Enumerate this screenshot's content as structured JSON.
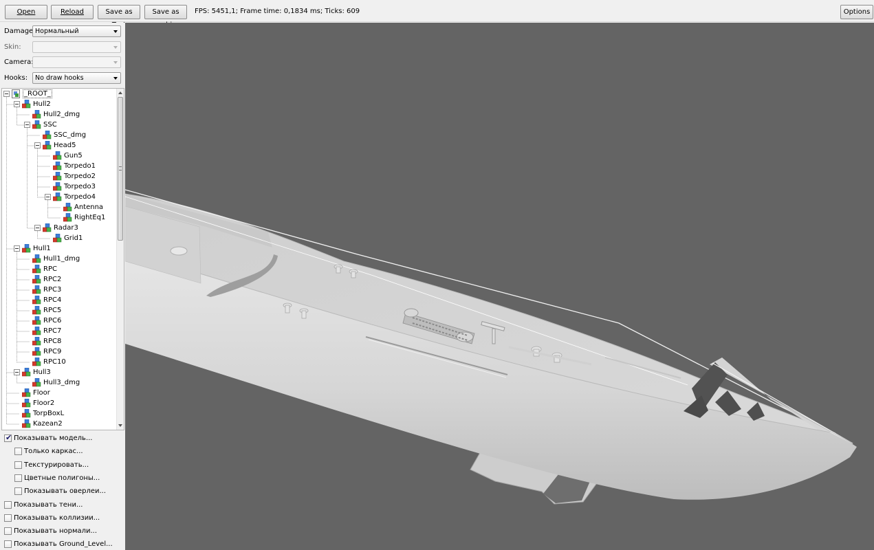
{
  "toolbar": {
    "open_label": "Open",
    "reload_label": "Reload",
    "save_text_label": "Save as Text",
    "save_obj_label": "Save as .obj",
    "status": "FPS: 5451,1; Frame time: 0,1834 ms; Ticks: 609",
    "options_label": "Options"
  },
  "controls": {
    "damage_label": "Damage:",
    "damage_value": "Нормальный",
    "skin_label": "Skin:",
    "skin_value": "",
    "camera_label": "Camera:",
    "camera_value": "",
    "hooks_label": "Hooks:",
    "hooks_value": "No draw hooks"
  },
  "tree": {
    "nodes": [
      {
        "label": "_ROOT_",
        "depth": 0,
        "expander": "minus",
        "icon": "root-icon"
      },
      {
        "label": "Hull2",
        "depth": 1,
        "expander": "minus",
        "icon": "node-icon"
      },
      {
        "label": "Hull2_dmg",
        "depth": 2,
        "expander": "",
        "icon": "node-icon"
      },
      {
        "label": "SSC",
        "depth": 2,
        "expander": "minus",
        "icon": "node-icon"
      },
      {
        "label": "SSC_dmg",
        "depth": 3,
        "expander": "",
        "icon": "node-icon"
      },
      {
        "label": "Head5",
        "depth": 3,
        "expander": "minus",
        "icon": "node-icon"
      },
      {
        "label": "Gun5",
        "depth": 4,
        "expander": "",
        "icon": "node-icon"
      },
      {
        "label": "Torpedo1",
        "depth": 4,
        "expander": "",
        "icon": "node-icon"
      },
      {
        "label": "Torpedo2",
        "depth": 4,
        "expander": "",
        "icon": "node-icon"
      },
      {
        "label": "Torpedo3",
        "depth": 4,
        "expander": "",
        "icon": "node-icon"
      },
      {
        "label": "Torpedo4",
        "depth": 4,
        "expander": "minus",
        "icon": "node-icon"
      },
      {
        "label": "Antenna",
        "depth": 5,
        "expander": "",
        "icon": "node-icon"
      },
      {
        "label": "RightEq1",
        "depth": 5,
        "expander": "",
        "icon": "node-icon"
      },
      {
        "label": "Radar3",
        "depth": 3,
        "expander": "minus",
        "icon": "node-icon"
      },
      {
        "label": "Grid1",
        "depth": 4,
        "expander": "",
        "icon": "node-icon"
      },
      {
        "label": "Hull1",
        "depth": 1,
        "expander": "minus",
        "icon": "node-icon"
      },
      {
        "label": "Hull1_dmg",
        "depth": 2,
        "expander": "",
        "icon": "node-icon"
      },
      {
        "label": "RPC",
        "depth": 2,
        "expander": "",
        "icon": "node-icon"
      },
      {
        "label": "RPC2",
        "depth": 2,
        "expander": "",
        "icon": "node-icon"
      },
      {
        "label": "RPC3",
        "depth": 2,
        "expander": "",
        "icon": "node-icon"
      },
      {
        "label": "RPC4",
        "depth": 2,
        "expander": "",
        "icon": "node-icon"
      },
      {
        "label": "RPC5",
        "depth": 2,
        "expander": "",
        "icon": "node-icon"
      },
      {
        "label": "RPC6",
        "depth": 2,
        "expander": "",
        "icon": "node-icon"
      },
      {
        "label": "RPC7",
        "depth": 2,
        "expander": "",
        "icon": "node-icon"
      },
      {
        "label": "RPC8",
        "depth": 2,
        "expander": "",
        "icon": "node-icon"
      },
      {
        "label": "RPC9",
        "depth": 2,
        "expander": "",
        "icon": "node-icon"
      },
      {
        "label": "RPC10",
        "depth": 2,
        "expander": "",
        "icon": "node-icon"
      },
      {
        "label": "Hull3",
        "depth": 1,
        "expander": "minus",
        "icon": "node-icon"
      },
      {
        "label": "Hull3_dmg",
        "depth": 2,
        "expander": "",
        "icon": "node-icon"
      },
      {
        "label": "Floor",
        "depth": 1,
        "expander": "",
        "icon": "node-icon"
      },
      {
        "label": "Floor2",
        "depth": 1,
        "expander": "",
        "icon": "node-icon"
      },
      {
        "label": "TorpBoxL",
        "depth": 1,
        "expander": "",
        "icon": "node-icon"
      },
      {
        "label": "Kazean2",
        "depth": 1,
        "expander": "",
        "icon": "node-icon"
      }
    ]
  },
  "options": [
    {
      "label": "Показывать модель...",
      "checked": true,
      "indent": 0
    },
    {
      "label": "Только каркас...",
      "checked": false,
      "indent": 1
    },
    {
      "label": "Текстурировать...",
      "checked": false,
      "indent": 1
    },
    {
      "label": "Цветные полигоны...",
      "checked": false,
      "indent": 1
    },
    {
      "label": "Показывать оверлеи...",
      "checked": false,
      "indent": 1
    },
    {
      "label": "Показывать тени...",
      "checked": false,
      "indent": 0
    },
    {
      "label": "Показывать коллизии...",
      "checked": false,
      "indent": 0
    },
    {
      "label": "Показывать нормали...",
      "checked": false,
      "indent": 0
    },
    {
      "label": "Показывать Ground_Level...",
      "checked": false,
      "indent": 0
    }
  ],
  "colors": {
    "viewport_bg": "#646464",
    "model_light": "#dcdcdc",
    "model_shadow": "#b8b8b8"
  }
}
